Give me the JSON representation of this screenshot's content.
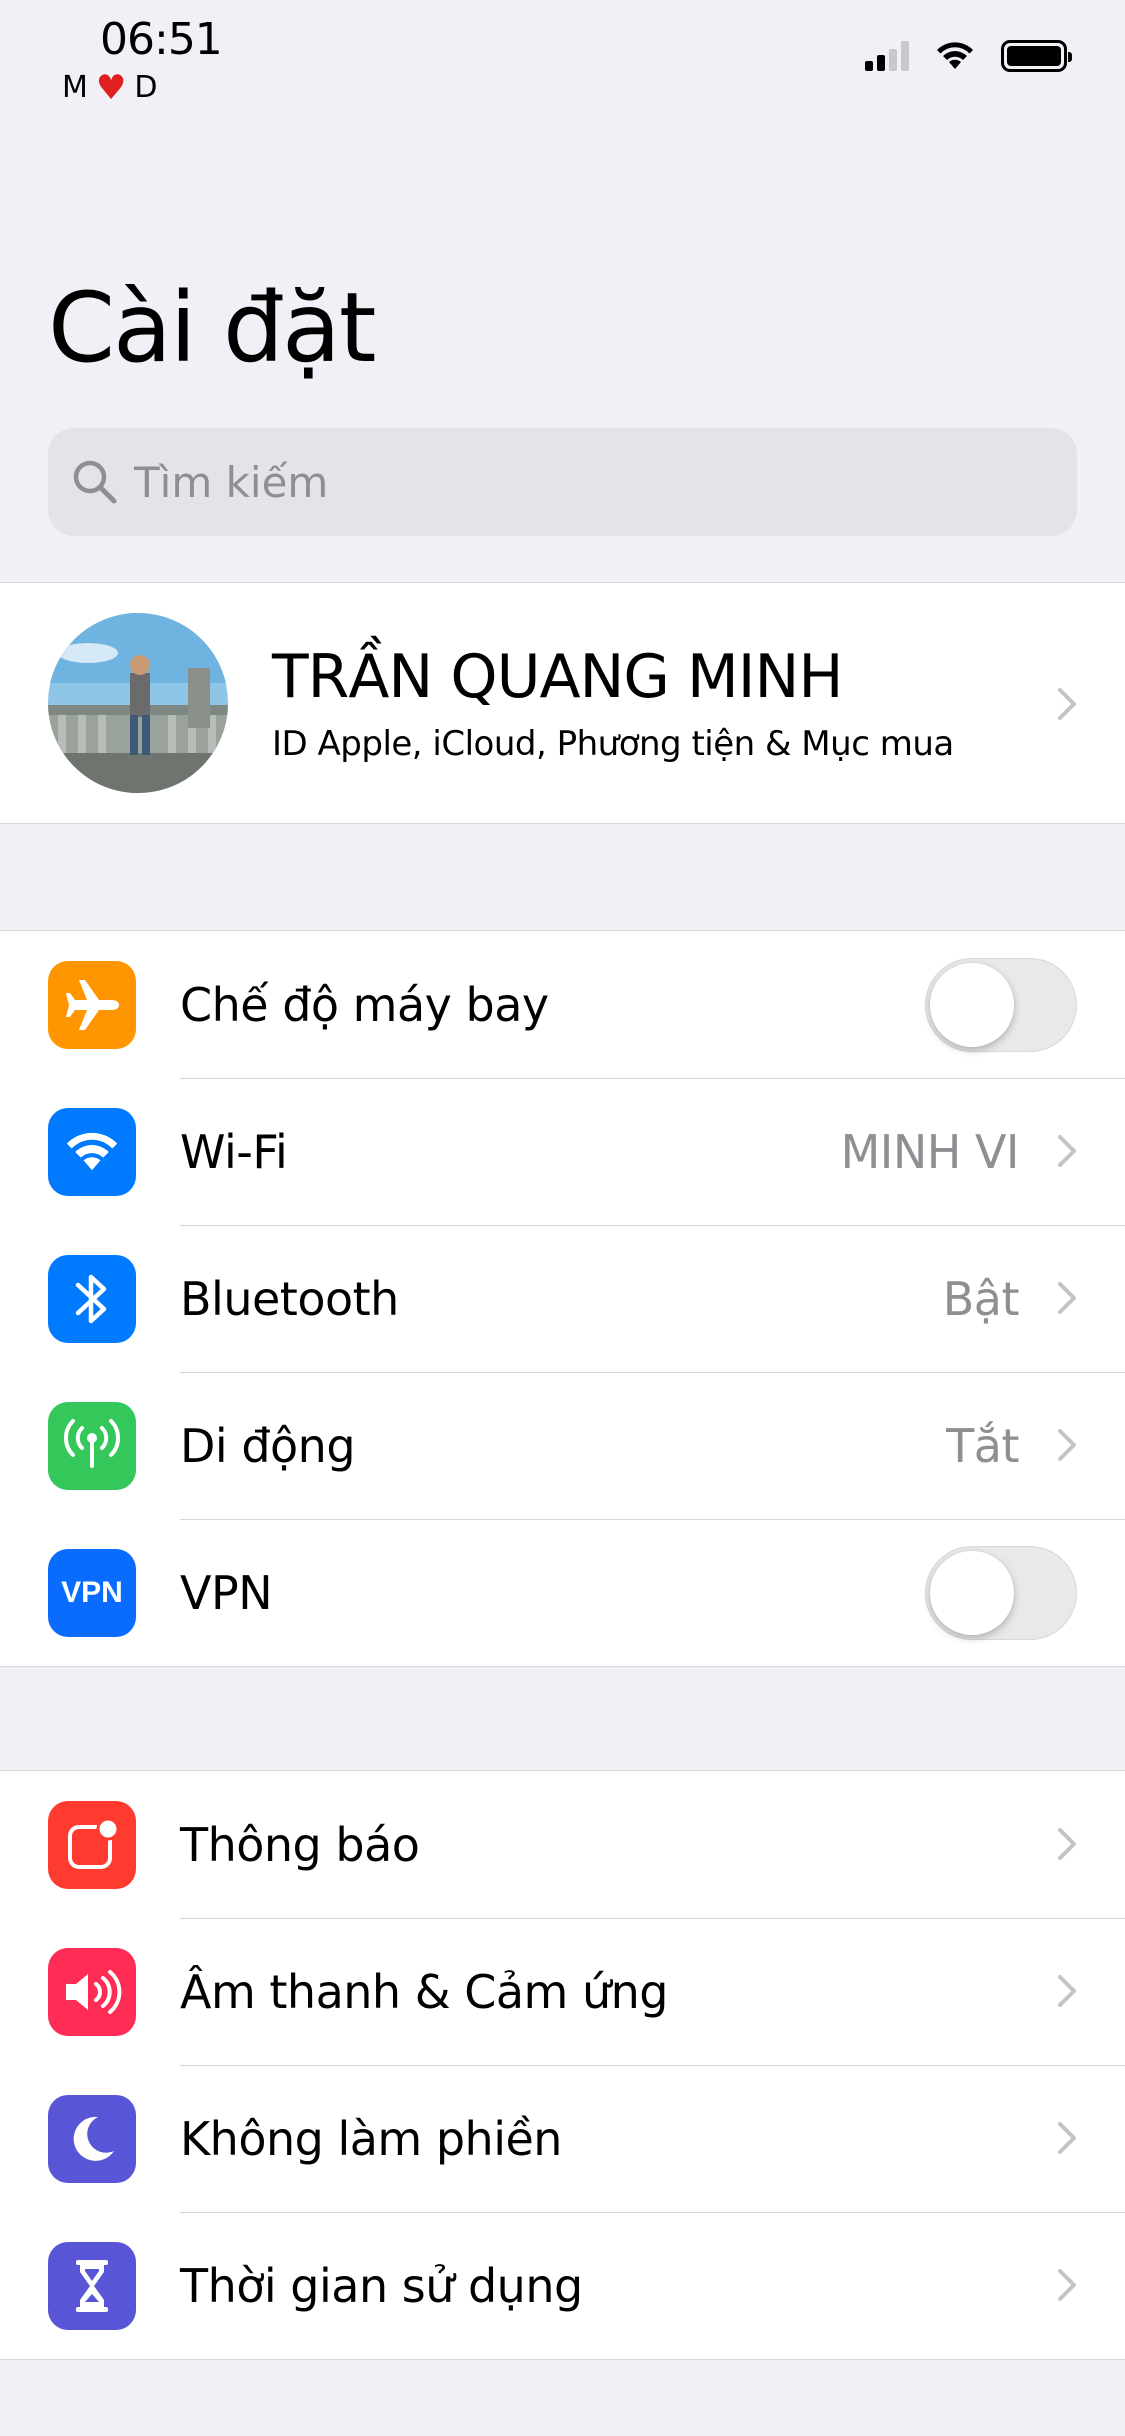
{
  "status_bar": {
    "time": "06:51",
    "carrier_left": "M",
    "carrier_right": "D"
  },
  "page": {
    "title": "Cài đặt"
  },
  "search": {
    "placeholder": "Tìm kiếm",
    "value": ""
  },
  "profile": {
    "name": "TRẦN QUANG MINH",
    "subtitle": "ID Apple, iCloud, Phương tiện & Mục mua"
  },
  "connectivity": [
    {
      "label": "Chế độ máy bay",
      "icon": "airplane-icon",
      "color": "#ff9500",
      "control": "toggle",
      "on": false
    },
    {
      "label": "Wi-Fi",
      "value": "MINH VI",
      "icon": "wifi-icon",
      "color": "#007aff"
    },
    {
      "label": "Bluetooth",
      "value": "Bật",
      "icon": "bluetooth-icon",
      "color": "#007aff"
    },
    {
      "label": "Di động",
      "value": "Tắt",
      "icon": "cellular-antenna-icon",
      "color": "#34c759"
    },
    {
      "label": "VPN",
      "icon_text": "VPN",
      "icon": "vpn-icon",
      "color": "#0a6cff",
      "control": "toggle",
      "on": false
    }
  ],
  "notifications_group": [
    {
      "label": "Thông báo",
      "icon": "notifications-icon",
      "color": "#ff3b30"
    },
    {
      "label": "Âm thanh & Cảm ứng",
      "icon": "speaker-icon",
      "color": "#ff2d55"
    },
    {
      "label": "Không làm phiền",
      "icon": "moon-icon",
      "color": "#5856d6"
    },
    {
      "label": "Thời gian sử dụng",
      "icon": "hourglass-icon",
      "color": "#5856d6"
    }
  ]
}
